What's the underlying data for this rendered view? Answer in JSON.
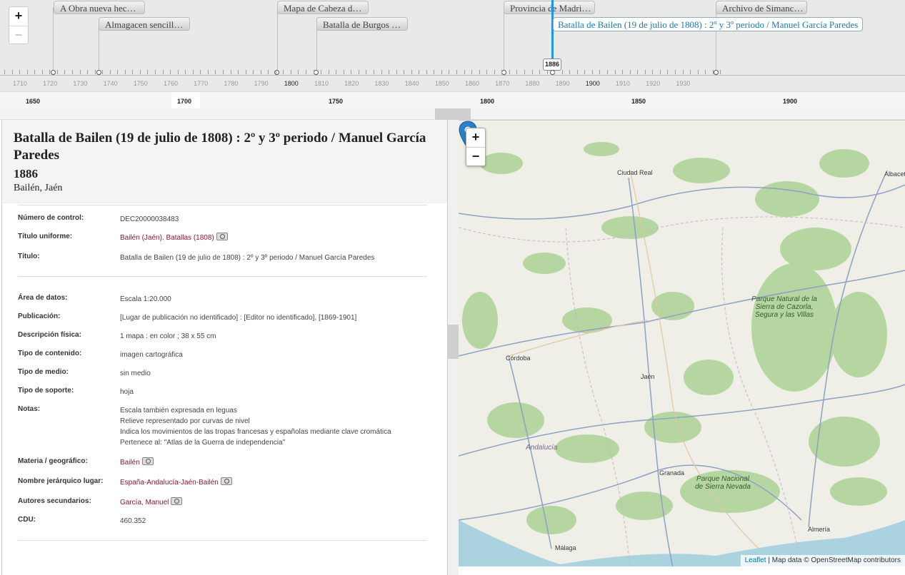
{
  "timeline": {
    "zoom_in": "+",
    "zoom_out": "−",
    "events": [
      {
        "label": "A Obra nueva hec…"
      },
      {
        "label": "Almagacen sencill…"
      },
      {
        "label": "Mapa de Cabeza d…"
      },
      {
        "label": "Batalla de Burgos …"
      },
      {
        "label": "Provincia de Madri…"
      },
      {
        "label": "Archivo de Simanc…"
      }
    ],
    "active_event": "Batalla de Bailen (19 de julio de 1808) : 2º y 3º periodo / Manuel García Paredes",
    "active_date": "1886",
    "minor_labels": [
      "1710",
      "1720",
      "1730",
      "1740",
      "1750",
      "1760",
      "1770",
      "1780",
      "1790",
      "1800",
      "1810",
      "1820",
      "1830",
      "1840",
      "1850",
      "1860",
      "1870",
      "1880",
      "1890",
      "1900",
      "1910",
      "1920",
      "1930"
    ],
    "major_labels": [
      "1650",
      "1700",
      "1750",
      "1800",
      "1850",
      "1900"
    ]
  },
  "record": {
    "title": "Batalla de Bailen (19 de julio de 1808) : 2º y 3º periodo / Manuel García Paredes",
    "year": "1886",
    "place": "Bailén, Jaén",
    "fields": [
      {
        "key": "Número de control:",
        "value": "DEC20000038483"
      },
      {
        "key": "Título uniforme:",
        "value": "Bailén (Jaén). Batallas (1808)"
      },
      {
        "key": "Título:",
        "value": "Batalla de Bailen (19 de julio de 1808) : 2º y 3º periodo / Manuel García Paredes"
      },
      {
        "key": "Área de datos:",
        "value": "Escala 1:20.000"
      },
      {
        "key": "Publicación:",
        "value": "[Lugar de publicación no identificado] : [Editor no identificado], [1869-1901]"
      },
      {
        "key": "Descripción física:",
        "value": "1 mapa : en color ; 38 x 55 cm"
      },
      {
        "key": "Tipo de contenido:",
        "value": "imagen cartográfica"
      },
      {
        "key": "Tipo de medio:",
        "value": "sin medio"
      },
      {
        "key": "Tipo de soporte:",
        "value": "hoja"
      },
      {
        "key": "Notas:",
        "value": "Escala también expresada en leguas"
      },
      {
        "key": "Materia / geográfico:",
        "value": "Bailén"
      },
      {
        "key": "Nombre jerárquico lugar:",
        "value": "España-Andalucía-Jaén-Bailén"
      },
      {
        "key": "Autores secundarios:",
        "value": "García, Manuel"
      },
      {
        "key": "CDU:",
        "value": "460.352"
      }
    ],
    "notes_extra": [
      "Relieve representado por curvas de nivel",
      "Indica los movimientos de las tropas francesas y españolas mediante clave cromática",
      "Pertenece al: \"Atlas de la Guerra de independencia\""
    ]
  },
  "map": {
    "zoom_in": "+",
    "zoom_out": "−",
    "attribution_leaflet": "Leaflet",
    "attribution_rest": " | Map data © OpenStreetMap contributors",
    "cities": [
      "Ciudad Real",
      "Albacete",
      "Córdoba",
      "Jaén",
      "Granada",
      "Almería",
      "Málaga"
    ],
    "region": "Andalucía",
    "parks": [
      "Parque Natural de la Sierra de Cazorla, Segura y las Villas",
      "Parque Nacional de Sierra Nevada"
    ],
    "marker_color": "#2a81cb"
  }
}
